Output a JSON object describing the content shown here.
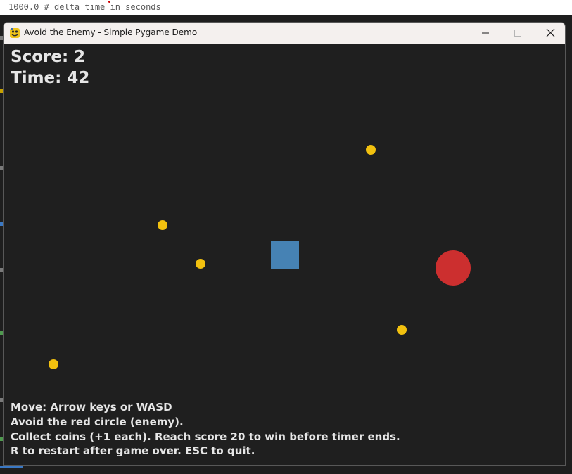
{
  "window": {
    "title": "Avoid the Enemy - Simple Pygame Demo",
    "app_icon": "python-icon",
    "controls": [
      "minimize-icon",
      "maximize-icon",
      "close-icon"
    ]
  },
  "background_editor": {
    "partial_code_line": "1000.0  # delta time in seconds"
  },
  "hud": {
    "score_text": "Score: 2",
    "time_text": "Time: 42"
  },
  "game": {
    "player_color": "#4682b4",
    "enemy_color": "#cc2f2f",
    "coin_color": "#f2c10f",
    "background_color": "#1f1f1f",
    "coin_count": 5
  },
  "instructions": [
    "Move: Arrow keys or WASD",
    "Avoid the red circle (enemy).",
    "Collect coins (+1 each). Reach score 20 to win before timer ends.",
    "R to restart after game over. ESC to quit."
  ]
}
